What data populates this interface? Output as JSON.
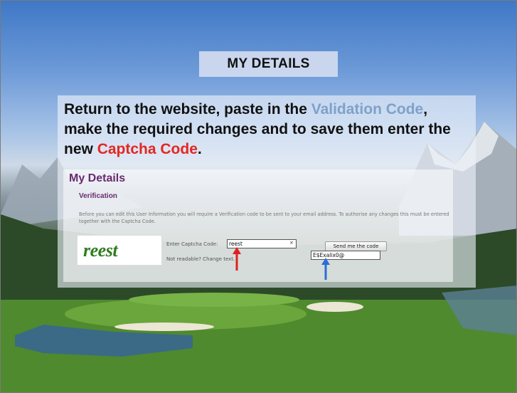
{
  "slide": {
    "title": "MY DETAILS",
    "instruction": {
      "part1": "Return to the website, paste in the ",
      "validation": "Validation Code",
      "part2": ", make the required changes and to save them enter the new ",
      "captcha": "Captcha Code",
      "part3": "."
    }
  },
  "panel": {
    "title": "My Details",
    "section": "Verification",
    "notice": "Before you can edit this User Information you will require a Verification code to be sent to your email address. To authorise any changes this must be entered together with the Captcha Code.",
    "captcha_image_text": "reest",
    "captcha_label": "Enter Captcha Code:",
    "captcha_value": "reest",
    "clear_icon": "×",
    "not_readable": "Not readable? Change text.",
    "send_button": "Send me the code",
    "code_value": "E$Exalix0@"
  },
  "colors": {
    "accent_blue": "#7fa1c9",
    "accent_red": "#e52621",
    "purple_heading": "#6a2a6e",
    "arrow_red": "#e02020",
    "arrow_blue": "#2a6fd6"
  }
}
